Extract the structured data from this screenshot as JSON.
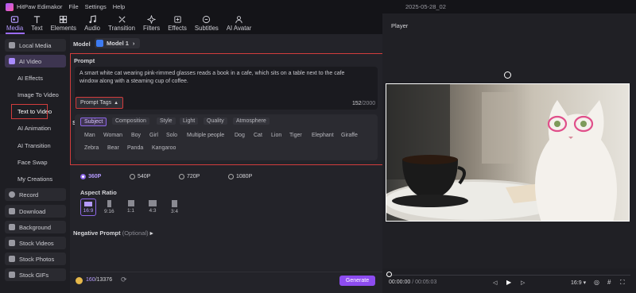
{
  "app": {
    "title": "HitPaw Edimakor",
    "menu": [
      "File",
      "Settings",
      "Help"
    ],
    "date": "2025-05-28_02"
  },
  "toolbar": {
    "items": [
      {
        "label": "Media",
        "icon": "media-icon",
        "active": true
      },
      {
        "label": "Text",
        "icon": "text-icon"
      },
      {
        "label": "Elements",
        "icon": "elements-icon"
      },
      {
        "label": "Audio",
        "icon": "audio-icon"
      },
      {
        "label": "Transition",
        "icon": "transition-icon"
      },
      {
        "label": "Filters",
        "icon": "filters-icon"
      },
      {
        "label": "Effects",
        "icon": "effects-icon"
      },
      {
        "label": "Subtitles",
        "icon": "subtitles-icon"
      },
      {
        "label": "AI Avatar",
        "icon": "ai-avatar-icon"
      }
    ]
  },
  "sidebar": {
    "items": [
      "Local Media",
      "AI Video",
      "AI Effects",
      "Image To Video",
      "Text to Video",
      "AI Animation",
      "AI Transition",
      "Face Swap",
      "My Creations",
      "Record",
      "Download",
      "Background",
      "Stock Videos",
      "Stock Photos",
      "Stock GIFs"
    ]
  },
  "model": {
    "label": "Model",
    "value": "Model 1"
  },
  "prompt": {
    "label": "Prompt",
    "text": "A smart white cat wearing pink-rimmed glasses reads a book in a cafe, which sits on a table next to the cafe window along with a steaming cup of coffee.",
    "count": "152",
    "max": "/2000",
    "tags_button": "Prompt Tags"
  },
  "tags": {
    "categories": [
      "Subject",
      "Composition",
      "Style",
      "Light",
      "Quality",
      "Atmosphere"
    ],
    "row1": [
      "Man",
      "Woman",
      "Boy",
      "Girl",
      "Solo",
      "Multiple people",
      "Dog",
      "Cat",
      "Lion",
      "Tiger",
      "Elephant",
      "Giraffe"
    ],
    "row2": [
      "Zebra",
      "Bear",
      "Panda",
      "Kangaroo"
    ],
    "section_initial": "S"
  },
  "resolution": {
    "options": [
      "360P",
      "540P",
      "720P",
      "1080P"
    ],
    "selected": "360P"
  },
  "aspect": {
    "label": "Aspect Ratio",
    "options": [
      "16:9",
      "9:16",
      "1:1",
      "4:3",
      "3:4"
    ],
    "selected": "16:9"
  },
  "negative": {
    "label": "Negative Prompt",
    "hint": "(Optional)"
  },
  "credits": {
    "used": "160",
    "total": "/13376"
  },
  "generate": {
    "label": "Generate"
  },
  "player": {
    "title": "Player",
    "time_current": "00:00:00",
    "time_total": "/ 00:05:03",
    "ratio": "16:9"
  },
  "colors": {
    "accent": "#8d67e8",
    "highlight": "#d23c3c"
  }
}
